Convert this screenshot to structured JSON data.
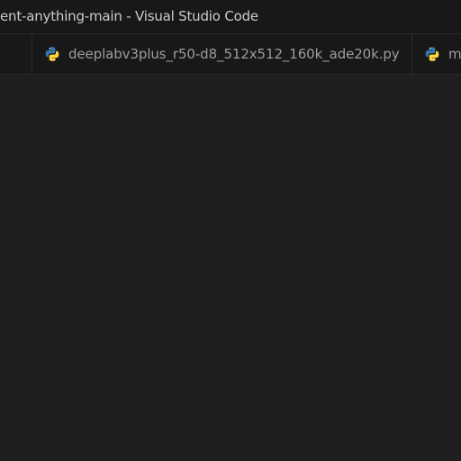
{
  "window": {
    "title": "ent-anything-main - Visual Studio Code"
  },
  "tabs": [
    {
      "label": "",
      "icon": "none"
    },
    {
      "label": "deeplabv3plus_r50-d8_512x512_160k_ade20k.py",
      "icon": "python-icon"
    },
    {
      "label": "m",
      "icon": "python-icon"
    }
  ],
  "colors": {
    "editor_bg": "#1f1f1f",
    "chrome_bg": "#181818",
    "text": "#cccccc",
    "tab_text": "#9d9d9d",
    "python_blue": "#3776ab",
    "python_yellow": "#ffd43b"
  }
}
